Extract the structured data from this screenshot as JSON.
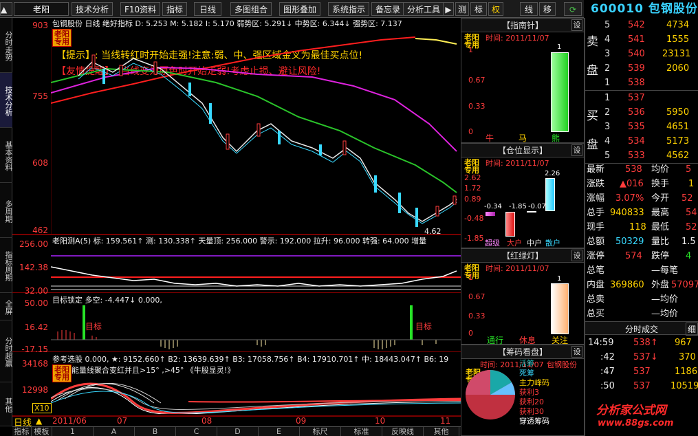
{
  "menu": {
    "stock_name": "老阳",
    "items": [
      "技术分析",
      "F10资料",
      "指标",
      "日线",
      "多图组合",
      "图形叠加",
      "系统指示",
      "备忘录",
      "分析工具"
    ],
    "small": [
      "测",
      "标",
      "权",
      "线",
      "移"
    ],
    "title": "600010 包钢股份"
  },
  "left_tabs": [
    "分时走势",
    "技术分析",
    "基本资料",
    "多周期",
    "指标周期",
    "全屏",
    "分时超赢",
    "其他"
  ],
  "main": {
    "header": "包钢股份 日线 绝好指标 D: 5.253 M: 5.182 I: 5.170 弱势区: 5.291↓ 中势区: 6.344↓ 强势区: 7.137",
    "tip1": "【提示】: 当线转红时开始走强!注意:弱、中、强区域金叉为最佳买点位!",
    "tip2": "【友情提醒】: 当线变为原色时开始走弱!考虑止损、避让风险!",
    "axis": [
      "903",
      "755",
      "608",
      "462"
    ],
    "low_label": "4.62",
    "tag": "老阳专用"
  },
  "ind1": {
    "header": "老阳测A(5) 标: 159.561↑ 测: 130.338↑ 天量顶: 256.000 警示: 192.000 拉升: 96.000 转强: 64.000 增量",
    "axis": [
      "256.00",
      "142.38",
      "32.00"
    ]
  },
  "ind2": {
    "header": "目标锁定 多空: -4.447↓ 0.000,",
    "axis": [
      "50.00",
      "16.42",
      "-17.15"
    ],
    "target_label": "目标"
  },
  "ind3": {
    "header": "参考选股 0.000, ★: 9152.660↑ B2: 13639.639↑ B3: 17058.756↑ B4: 17910.701↑ 中: 18443.047↑ B6: 19",
    "sub": "能量线聚合变红并且>15° ,>45° 《牛股显灵!》",
    "axis": [
      "34168",
      "12998"
    ],
    "x10": "X10"
  },
  "date_axis": [
    "2011/06",
    "07",
    "08",
    "09",
    "10",
    "11"
  ],
  "period_label": "日线",
  "bottom_tabs": [
    "指标",
    "模板",
    "1",
    "A",
    "B",
    "C",
    "D",
    "E",
    "标尺",
    "标准",
    "反映线",
    "其他"
  ],
  "panels": {
    "compass": {
      "title": "【指南针】",
      "set": "设",
      "time": "时间: 2011/11/07",
      "tag": "老阳专用",
      "axis": [
        "1",
        "0.67",
        "0.33",
        "0"
      ],
      "labels": [
        "牛",
        "马",
        "熊"
      ],
      "bar_value": "1"
    },
    "position": {
      "title": "【仓位显示】",
      "set": "设",
      "time": "时间: 2011/11/07",
      "tag": "老阳专用",
      "axis": [
        "2.62",
        "1.72",
        "0.89",
        "-0.48",
        "-1.85"
      ],
      "values": [
        "-0.34",
        "-1.85",
        "-0.07",
        "2.26"
      ],
      "labels": [
        "超级",
        "大户",
        "中户",
        "散户"
      ]
    },
    "light": {
      "title": "【红绿灯】",
      "set": "设",
      "time": "时间: 2011/11/07",
      "tag": "老阳专用",
      "axis": [
        "1",
        "0.67",
        "0.33",
        "0"
      ],
      "labels": [
        "通行",
        "休息",
        "关注"
      ],
      "bar_value": "1"
    },
    "chip": {
      "title": "【筹码看盘】",
      "set": "设",
      "time": "时间: 2011/11/07",
      "tag": "老阳专用",
      "legend": [
        "活筹",
        "死筹",
        "主力峰码",
        "获利3",
        "获利20",
        "获利30",
        "穿透筹码"
      ],
      "stock": "包钢股份"
    }
  },
  "book": {
    "sell": [
      [
        "5",
        "542",
        "4734"
      ],
      [
        "4",
        "541",
        "1555"
      ],
      [
        "3",
        "540",
        "23131"
      ],
      [
        "2",
        "539",
        "2060"
      ],
      [
        "1",
        "538",
        ""
      ]
    ],
    "buy": [
      [
        "1",
        "537",
        ""
      ],
      [
        "2",
        "536",
        "5950"
      ],
      [
        "3",
        "535",
        "4651"
      ],
      [
        "4",
        "534",
        "5173"
      ],
      [
        "5",
        "533",
        "4562"
      ]
    ],
    "sell_label": [
      "卖",
      "盘"
    ],
    "buy_label": [
      "买",
      "盘"
    ],
    "stats": [
      [
        "最新",
        "538",
        "均价",
        "5"
      ],
      [
        "涨跌",
        "▲016",
        "换手",
        "1"
      ],
      [
        "涨幅",
        "3.07%",
        "今开",
        "52"
      ],
      [
        "总手",
        "940833",
        "最高",
        "54"
      ],
      [
        "现手",
        "118",
        "最低",
        "52"
      ],
      [
        "总额",
        "50329",
        "量比",
        "1.5"
      ],
      [
        "涨停",
        "574",
        "跌停",
        "4"
      ],
      [
        "总笔",
        "",
        "—每笔",
        ""
      ],
      [
        "内盘",
        "369860",
        "外盘",
        "57097"
      ],
      [
        "总卖",
        "",
        "—均价",
        ""
      ],
      [
        "总买",
        "",
        "—均价",
        ""
      ]
    ],
    "ticks_title": "分时成交",
    "ticks_tab": "细",
    "ticks": [
      [
        "14:59",
        "538↑",
        "967"
      ],
      [
        ":42",
        "537↓",
        "370"
      ],
      [
        ":47",
        "537",
        "1186"
      ],
      [
        ":50",
        "537",
        "10519"
      ]
    ],
    "watermark": "分析家公式网",
    "watermark_url": "www.88gs.com"
  },
  "colors": {
    "up": "#ff3c3c",
    "down": "#38d9ff",
    "accent": "#ffd200"
  }
}
